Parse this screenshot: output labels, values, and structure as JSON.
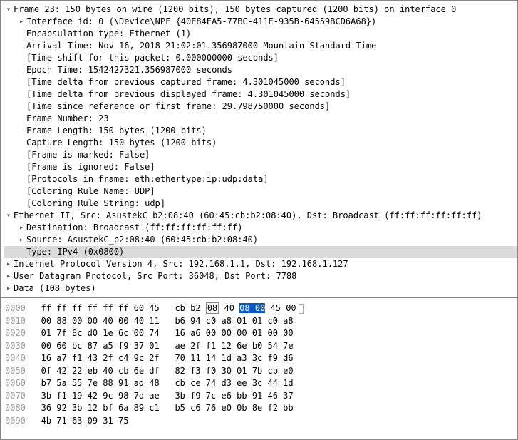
{
  "tree": {
    "frame": {
      "summary": "Frame 23: 150 bytes on wire (1200 bits), 150 bytes captured (1200 bits) on interface 0",
      "interface_id": "Interface id: 0 (\\Device\\NPF_{40E84EA5-77BC-411E-935B-64559BCD6A68})",
      "encap": "Encapsulation type: Ethernet (1)",
      "arrival": "Arrival Time: Nov 16, 2018 21:02:01.356987000 Mountain Standard Time",
      "time_shift": "[Time shift for this packet: 0.000000000 seconds]",
      "epoch": "Epoch Time: 1542427321.356987000 seconds",
      "delta_cap": "[Time delta from previous captured frame: 4.301045000 seconds]",
      "delta_disp": "[Time delta from previous displayed frame: 4.301045000 seconds]",
      "since_ref": "[Time since reference or first frame: 29.798750000 seconds]",
      "frame_num": "Frame Number: 23",
      "frame_len": "Frame Length: 150 bytes (1200 bits)",
      "cap_len": "Capture Length: 150 bytes (1200 bits)",
      "marked": "[Frame is marked: False]",
      "ignored": "[Frame is ignored: False]",
      "protocols": "[Protocols in frame: eth:ethertype:ip:udp:data]",
      "color_name": "[Coloring Rule Name: UDP]",
      "color_str": "[Coloring Rule String: udp]"
    },
    "eth": {
      "summary": "Ethernet II, Src: AsustekC_b2:08:40 (60:45:cb:b2:08:40), Dst: Broadcast (ff:ff:ff:ff:ff:ff)",
      "dst": "Destination: Broadcast (ff:ff:ff:ff:ff:ff)",
      "src": "Source: AsustekC_b2:08:40 (60:45:cb:b2:08:40)",
      "type": "Type: IPv4 (0x0800)"
    },
    "ip": "Internet Protocol Version 4, Src: 192.168.1.1, Dst: 192.168.1.127",
    "udp": "User Datagram Protocol, Src Port: 36048, Dst Port: 7788",
    "data": "Data (108 bytes)"
  },
  "hex": {
    "rows": [
      {
        "off": "0000",
        "a": "ff ff ff ff ff ff 60 45",
        "b_pre": "cb b2 ",
        "b_sel1": "08",
        "b_mid": " 40 ",
        "b_sel2": "08 00",
        "b_post": " 45 00",
        "sel": true
      },
      {
        "off": "0010",
        "a": "00 88 00 00 40 00 40 11",
        "b": "b6 94 c0 a8 01 01 c0 a8"
      },
      {
        "off": "0020",
        "a": "01 7f 8c d0 1e 6c 00 74",
        "b": "16 a6 00 00 00 01 00 00"
      },
      {
        "off": "0030",
        "a": "00 60 bc 87 a5 f9 37 01",
        "b": "ae 2f f1 12 6e b0 54 7e"
      },
      {
        "off": "0040",
        "a": "16 a7 f1 43 2f c4 9c 2f",
        "b": "70 11 14 1d a3 3c f9 d6"
      },
      {
        "off": "0050",
        "a": "0f 42 22 eb 40 cb 6e df",
        "b": "82 f3 f0 30 01 7b cb e0"
      },
      {
        "off": "0060",
        "a": "b7 5a 55 7e 88 91 ad 48",
        "b": "cb ce 74 d3 ee 3c 44 1d"
      },
      {
        "off": "0070",
        "a": "3b f1 19 42 9c 98 7d ae",
        "b": "3b f9 7c e6 bb 91 46 37"
      },
      {
        "off": "0080",
        "a": "36 92 3b 12 bf 6a 89 c1",
        "b": "b5 c6 76 e0 0b 8e f2 bb"
      },
      {
        "off": "0090",
        "a": "4b 71 63 09 31 75",
        "b": ""
      }
    ]
  }
}
